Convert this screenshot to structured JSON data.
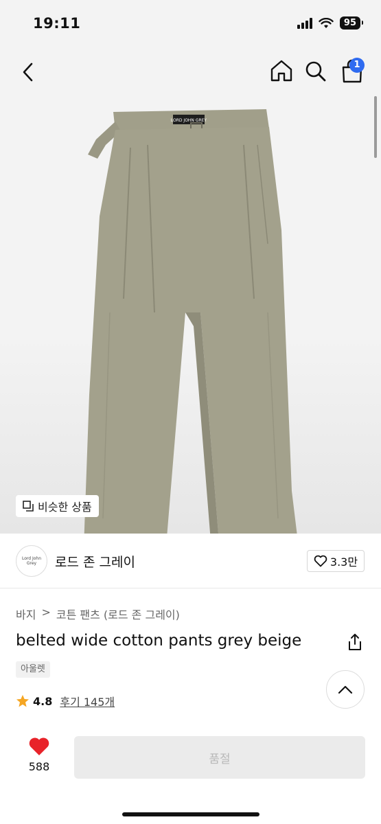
{
  "status": {
    "time": "19:11",
    "battery": "95"
  },
  "nav": {
    "cart_count": "1"
  },
  "hero": {
    "similar_label": "비슷한 상품",
    "product_label": "LORD JOHN GREY"
  },
  "brand": {
    "logo_text": "Lord John Grey",
    "name": "로드 존 그레이",
    "likes": "3.3만"
  },
  "breadcrumb": {
    "category": "바지",
    "separator": ">",
    "subcategory": "코튼 팬츠 (로드 존 그레이)"
  },
  "product": {
    "title": "belted wide cotton pants grey beige",
    "tag": "아울렛",
    "rating": "4.8",
    "reviews": "후기 145개"
  },
  "bottom": {
    "wish_count": "588",
    "buy_label": "품절"
  },
  "colors": {
    "accent": "#2f6bf0",
    "heart": "#e8232a",
    "star": "#f5a623",
    "pants": "#a3a18c"
  }
}
